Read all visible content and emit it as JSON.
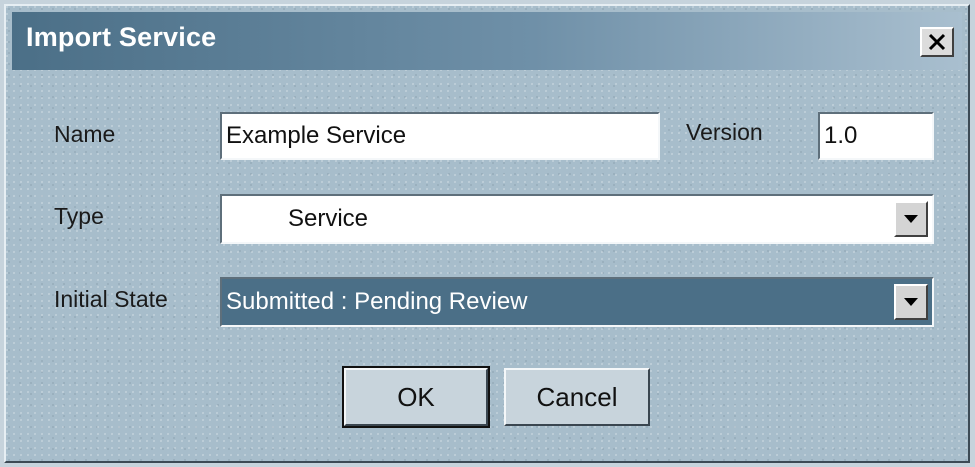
{
  "dialog": {
    "title": "Import Service",
    "close_icon": "close-icon"
  },
  "form": {
    "name_label": "Name",
    "name_value": "Example Service",
    "version_label": "Version",
    "version_value": "1.0",
    "type_label": "Type",
    "type_value": "Service",
    "initial_state_label": "Initial State",
    "initial_state_value": "Submitted : Pending Review"
  },
  "buttons": {
    "ok_label": "OK",
    "cancel_label": "Cancel"
  },
  "colors": {
    "dialog_background": "#a7bdcb",
    "titlebar_start": "#4b6f87",
    "titlebar_end": "#a9bfcf",
    "selected_state_background": "#4b6f87",
    "selected_state_text": "#ffffff"
  }
}
